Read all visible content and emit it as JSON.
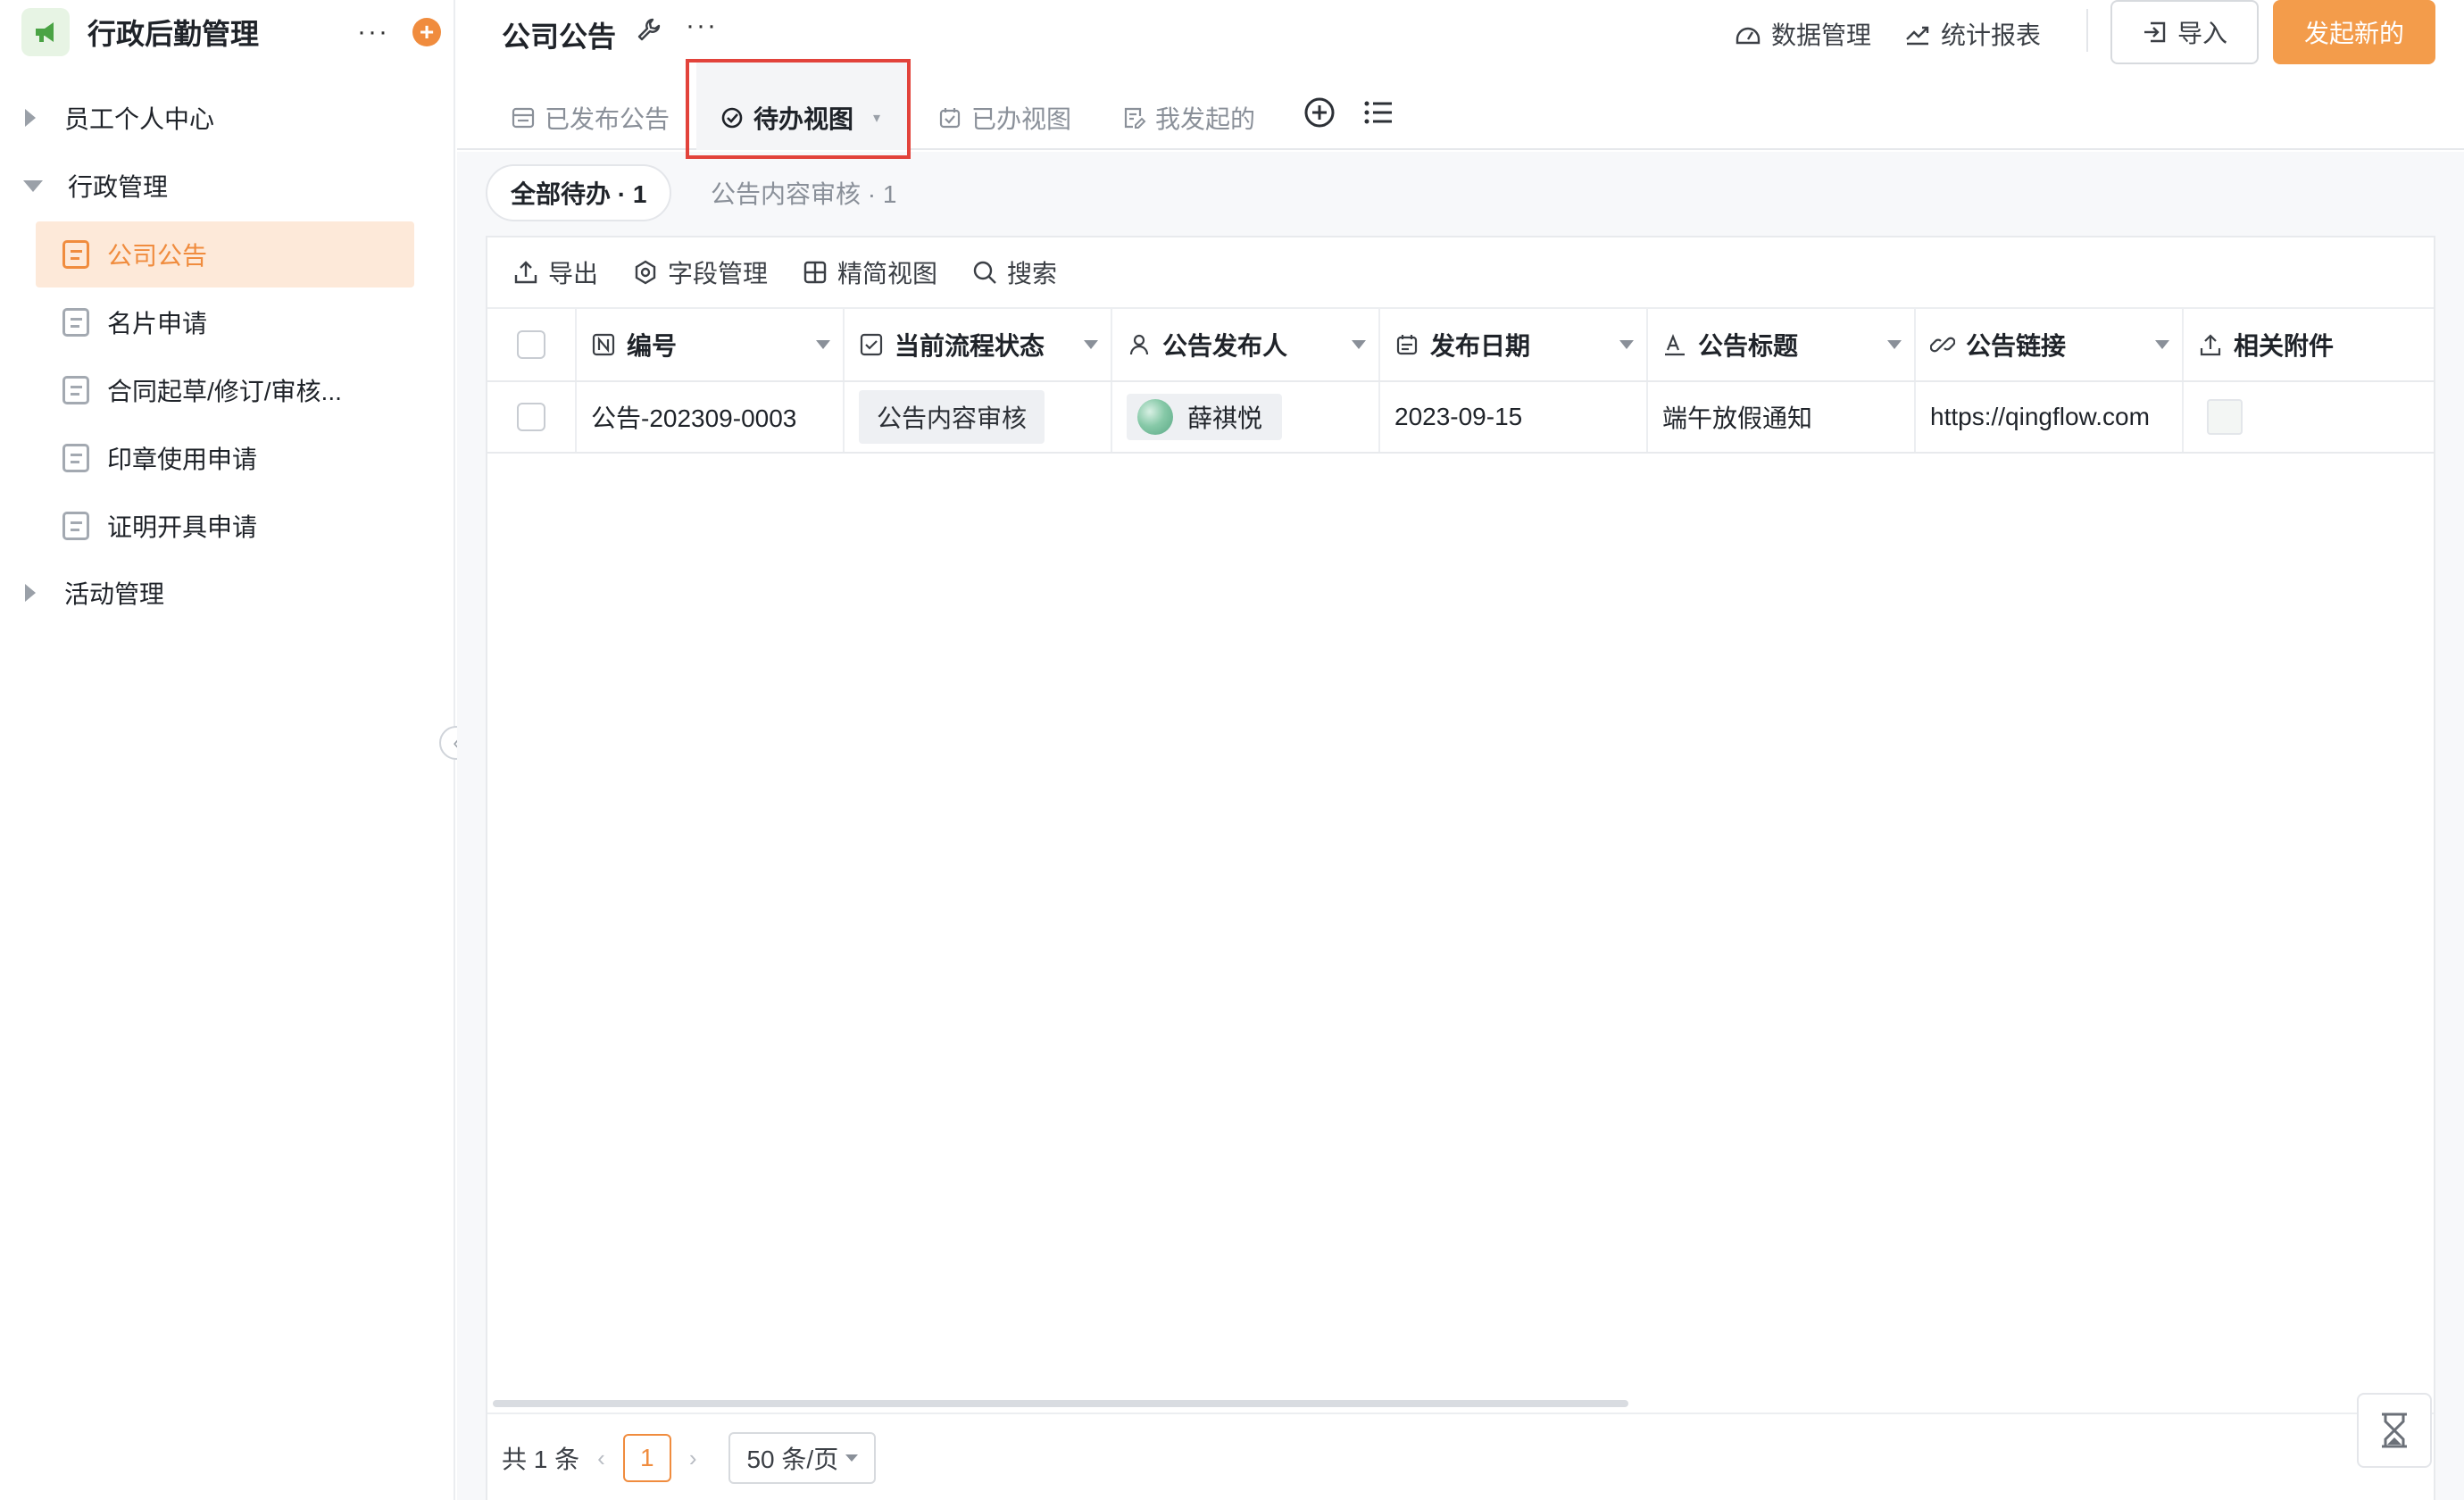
{
  "sidebar": {
    "app_title": "行政后勤管理",
    "more_label": "···",
    "add_label": "+",
    "groups": [
      {
        "label": "员工个人中心"
      },
      {
        "label": "行政管理"
      },
      {
        "label": "活动管理"
      }
    ],
    "items": [
      {
        "label": "公司公告"
      },
      {
        "label": "名片申请"
      },
      {
        "label": "合同起草/修订/审核..."
      },
      {
        "label": "印章使用申请"
      },
      {
        "label": "证明开具申请"
      }
    ],
    "collapse_label": "‹"
  },
  "header": {
    "title": "公司公告",
    "more_label": "···",
    "data_manage": "数据管理",
    "report": "统计报表",
    "import": "导入",
    "new": "发起新的"
  },
  "tabs": [
    {
      "label": "已发布公告"
    },
    {
      "label": "待办视图"
    },
    {
      "label": "已办视图"
    },
    {
      "label": "我发起的"
    }
  ],
  "filters": [
    {
      "label": "全部待办 · 1"
    },
    {
      "label": "公告内容审核 · 1"
    }
  ],
  "toolbar": {
    "export": "导出",
    "fields": "字段管理",
    "compact": "精简视图",
    "search": "搜索"
  },
  "table": {
    "columns": [
      "编号",
      "当前流程状态",
      "公告发布人",
      "发布日期",
      "公告标题",
      "公告链接",
      "相关附件"
    ],
    "rows": [
      {
        "id": "公告-202309-0003",
        "status": "公告内容审核",
        "publisher": "薛祺悦",
        "date": "2023-09-15",
        "title": "端午放假通知",
        "link": "https://qingflow.com"
      }
    ]
  },
  "pagination": {
    "total": "共 1 条",
    "prev": "‹",
    "current": "1",
    "next": "›",
    "page_size": "50 条/页"
  },
  "colors": {
    "accent": "#f08c3e",
    "highlight_border": "#e2433b",
    "active_nav_bg": "#fde9d9"
  }
}
